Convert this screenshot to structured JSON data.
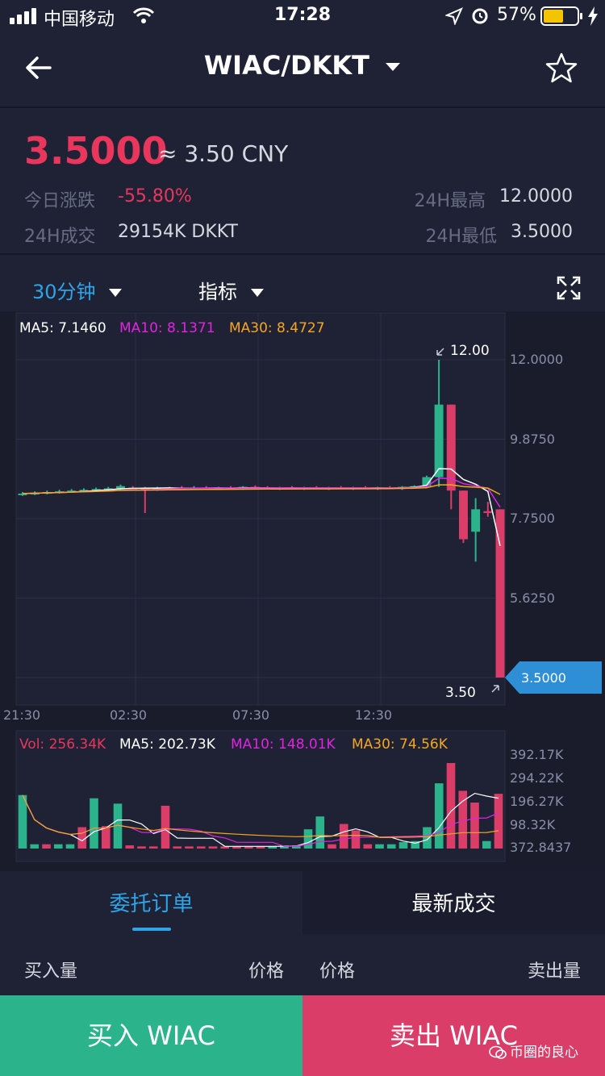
{
  "status_bar": {
    "carrier": "中国移动",
    "time": "17:28",
    "battery": "57%"
  },
  "header": {
    "pair": "WIAC/DKKT"
  },
  "ticker": {
    "price": "3.5000",
    "cny": "≈ 3.50 CNY",
    "change_label": "今日涨跌",
    "change_value": "-55.80%",
    "volume_label": "24H成交",
    "volume_value": "29154K DKKT",
    "high_label": "24H最高",
    "high_value": "12.0000",
    "low_label": "24H最低",
    "low_value": "3.5000"
  },
  "toolbar": {
    "interval": "30分钟",
    "indicators": "指标"
  },
  "price_chart": {
    "ma5_text": "MA5: 7.1460",
    "ma10_text": "MA10: 8.1371",
    "ma30_text": "MA30: 8.4727",
    "y_ticks": [
      "12.0000",
      "9.8750",
      "7.7500",
      "5.6250"
    ],
    "last_price": "3.5000",
    "max_label": "12.00",
    "min_label": "3.50",
    "x_ticks": [
      "21:30",
      "02:30",
      "07:30",
      "12:30"
    ]
  },
  "volume_chart": {
    "vol_text": "Vol: 256.34K",
    "ma5_text": "MA5: 202.73K",
    "ma10_text": "MA10: 148.01K",
    "ma30_text": "MA30: 74.56K",
    "y_ticks": [
      "392.17K",
      "294.22K",
      "196.27K",
      "98.32K",
      "372.8437"
    ]
  },
  "tabs": {
    "orders": "委托订单",
    "trades": "最新成交"
  },
  "book": {
    "buy_qty": "买入量",
    "price_left": "价格",
    "price_right": "价格",
    "sell_qty": "卖出量"
  },
  "actions": {
    "buy": "买入 WIAC",
    "sell": "卖出 WIAC"
  },
  "watermark": "币圈的良心",
  "colors": {
    "background": "#1f2235",
    "up": "#2bb38c",
    "down": "#d93d68",
    "accent": "#2fa4e7",
    "ma5": "#ffffff",
    "ma10": "#e024e0",
    "ma30": "#f5a623"
  },
  "chart_data": [
    {
      "type": "candlestick",
      "x_ticks": [
        "21:30",
        "02:30",
        "07:30",
        "12:30"
      ],
      "y_ticks": [
        12.0,
        9.875,
        7.75,
        5.625
      ],
      "ylim": [
        3.3,
        13.0
      ],
      "series": [
        {
          "name": "MA5",
          "value": 7.146
        },
        {
          "name": "MA10",
          "value": 8.1371
        },
        {
          "name": "MA30",
          "value": 8.4727
        }
      ],
      "candles": [
        {
          "o": 8.4,
          "h": 8.46,
          "l": 8.36,
          "c": 8.42
        },
        {
          "o": 8.42,
          "h": 8.48,
          "l": 8.38,
          "c": 8.44
        },
        {
          "o": 8.44,
          "h": 8.5,
          "l": 8.4,
          "c": 8.46
        },
        {
          "o": 8.46,
          "h": 8.52,
          "l": 8.42,
          "c": 8.48
        },
        {
          "o": 8.48,
          "h": 8.54,
          "l": 8.44,
          "c": 8.5
        },
        {
          "o": 8.5,
          "h": 8.56,
          "l": 8.46,
          "c": 8.52
        },
        {
          "o": 8.52,
          "h": 8.58,
          "l": 8.48,
          "c": 8.54
        },
        {
          "o": 8.54,
          "h": 8.6,
          "l": 8.5,
          "c": 8.56
        },
        {
          "o": 8.56,
          "h": 8.66,
          "l": 8.52,
          "c": 8.62
        },
        {
          "o": 8.58,
          "h": 8.62,
          "l": 8.54,
          "c": 8.56
        },
        {
          "o": 8.56,
          "h": 8.6,
          "l": 7.9,
          "c": 8.54
        },
        {
          "o": 8.54,
          "h": 8.6,
          "l": 8.5,
          "c": 8.56
        },
        {
          "o": 8.56,
          "h": 8.6,
          "l": 8.52,
          "c": 8.58
        },
        {
          "o": 8.58,
          "h": 8.62,
          "l": 8.54,
          "c": 8.56
        },
        {
          "o": 8.56,
          "h": 8.62,
          "l": 8.52,
          "c": 8.58
        },
        {
          "o": 8.58,
          "h": 8.62,
          "l": 8.54,
          "c": 8.56
        },
        {
          "o": 8.56,
          "h": 8.6,
          "l": 8.52,
          "c": 8.58
        },
        {
          "o": 8.58,
          "h": 8.62,
          "l": 8.54,
          "c": 8.56
        },
        {
          "o": 8.56,
          "h": 8.62,
          "l": 8.52,
          "c": 8.6
        },
        {
          "o": 8.6,
          "h": 8.64,
          "l": 8.56,
          "c": 8.58
        },
        {
          "o": 8.58,
          "h": 8.62,
          "l": 8.54,
          "c": 8.56
        },
        {
          "o": 8.56,
          "h": 8.6,
          "l": 8.52,
          "c": 8.58
        },
        {
          "o": 8.58,
          "h": 8.62,
          "l": 8.54,
          "c": 8.56
        },
        {
          "o": 8.56,
          "h": 8.6,
          "l": 8.52,
          "c": 8.58
        },
        {
          "o": 8.58,
          "h": 8.62,
          "l": 8.54,
          "c": 8.56
        },
        {
          "o": 8.56,
          "h": 8.6,
          "l": 8.52,
          "c": 8.58
        },
        {
          "o": 8.58,
          "h": 8.62,
          "l": 8.54,
          "c": 8.56
        },
        {
          "o": 8.56,
          "h": 8.6,
          "l": 8.52,
          "c": 8.58
        },
        {
          "o": 8.58,
          "h": 8.62,
          "l": 8.54,
          "c": 8.56
        },
        {
          "o": 8.56,
          "h": 8.6,
          "l": 8.52,
          "c": 8.58
        },
        {
          "o": 8.58,
          "h": 8.62,
          "l": 8.54,
          "c": 8.56
        },
        {
          "o": 8.56,
          "h": 8.62,
          "l": 8.52,
          "c": 8.6
        },
        {
          "o": 8.6,
          "h": 8.64,
          "l": 8.56,
          "c": 8.62
        },
        {
          "o": 8.62,
          "h": 8.9,
          "l": 8.58,
          "c": 8.86
        },
        {
          "o": 8.86,
          "h": 12.0,
          "l": 8.6,
          "c": 10.8
        },
        {
          "o": 10.8,
          "h": 10.8,
          "l": 8.0,
          "c": 8.5
        },
        {
          "o": 8.5,
          "h": 8.5,
          "l": 7.1,
          "c": 7.2
        },
        {
          "o": 7.4,
          "h": 8.3,
          "l": 6.6,
          "c": 8.0
        },
        {
          "o": 7.95,
          "h": 8.2,
          "l": 7.8,
          "c": 7.9
        },
        {
          "o": 8.0,
          "h": 8.0,
          "l": 3.5,
          "c": 3.5
        }
      ]
    },
    {
      "type": "bar",
      "series": [
        {
          "name": "Vol",
          "value": "256.34K"
        },
        {
          "name": "MA5",
          "value": "202.73K"
        },
        {
          "name": "MA10",
          "value": "148.01K"
        },
        {
          "name": "MA30",
          "value": "74.56K"
        }
      ],
      "ylim": [
        0,
        430
      ],
      "y_ticks": [
        "392.17K",
        "294.22K",
        "196.27K",
        "98.32K",
        "372.8437"
      ],
      "values": [
        250,
        20,
        20,
        20,
        20,
        100,
        235,
        105,
        210,
        15,
        10,
        10,
        200,
        10,
        10,
        10,
        10,
        10,
        10,
        10,
        10,
        10,
        15,
        15,
        90,
        150,
        20,
        115,
        85,
        20,
        20,
        20,
        30,
        35,
        100,
        305,
        400,
        270,
        215,
        35,
        256
      ],
      "up": [
        true,
        true,
        false,
        true,
        true,
        false,
        true,
        false,
        true,
        false,
        false,
        false,
        false,
        false,
        false,
        false,
        false,
        false,
        false,
        false,
        false,
        true,
        true,
        true,
        true,
        true,
        false,
        false,
        false,
        false,
        true,
        true,
        true,
        true,
        true,
        true,
        false,
        false,
        false,
        true,
        false
      ]
    }
  ]
}
